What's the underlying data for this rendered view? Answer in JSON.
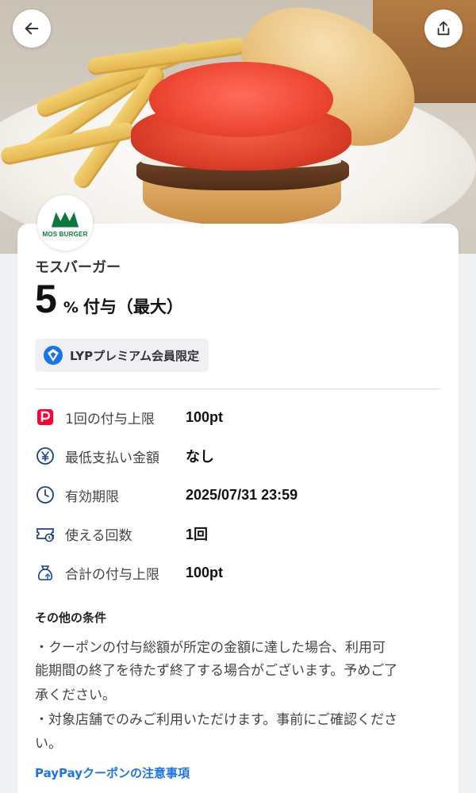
{
  "hero": {
    "image": "mos-burger-photo"
  },
  "header": {
    "back_icon": "arrow-left-icon",
    "share_icon": "share-icon"
  },
  "store": {
    "logo_text": "MOS BURGER",
    "logo_color": "#0a7a3c",
    "name": "モスバーガー"
  },
  "reward": {
    "rate": "5",
    "unit": "%",
    "label": "付与（最大）"
  },
  "badge": {
    "label": "LYPプレミアム会員限定",
    "icon": "lyp-premium-icon"
  },
  "info": [
    {
      "icon": "paypay-icon",
      "label": "1回の付与上限",
      "value": "100pt"
    },
    {
      "icon": "yen-icon",
      "label": "最低支払い金額",
      "value": "なし"
    },
    {
      "icon": "clock-icon",
      "label": "有効期限",
      "value": "2025/07/31 23:59"
    },
    {
      "icon": "ticket-icon",
      "label": "使える回数",
      "value": "1回"
    },
    {
      "icon": "money-bag-icon",
      "label": "合計の付与上限",
      "value": "100pt"
    }
  ],
  "conditions": {
    "title": "その他の条件",
    "line1a": "・クーポンの付与総額が所定の金額に達した場合、利用可",
    "line1b": "能期間の終了を待たず終了する場合がございます。予めご了",
    "line1c": "承ください。",
    "line2a": "・対象店舗でのみご利用いただけます。事前にご確認くださ",
    "line2b": "い。"
  },
  "link": {
    "label": "PayPayクーポンの注意事項"
  },
  "colors": {
    "accent": "#1a73e8",
    "paypay_red": "#ff0033",
    "brand_green": "#0a7a3c"
  }
}
